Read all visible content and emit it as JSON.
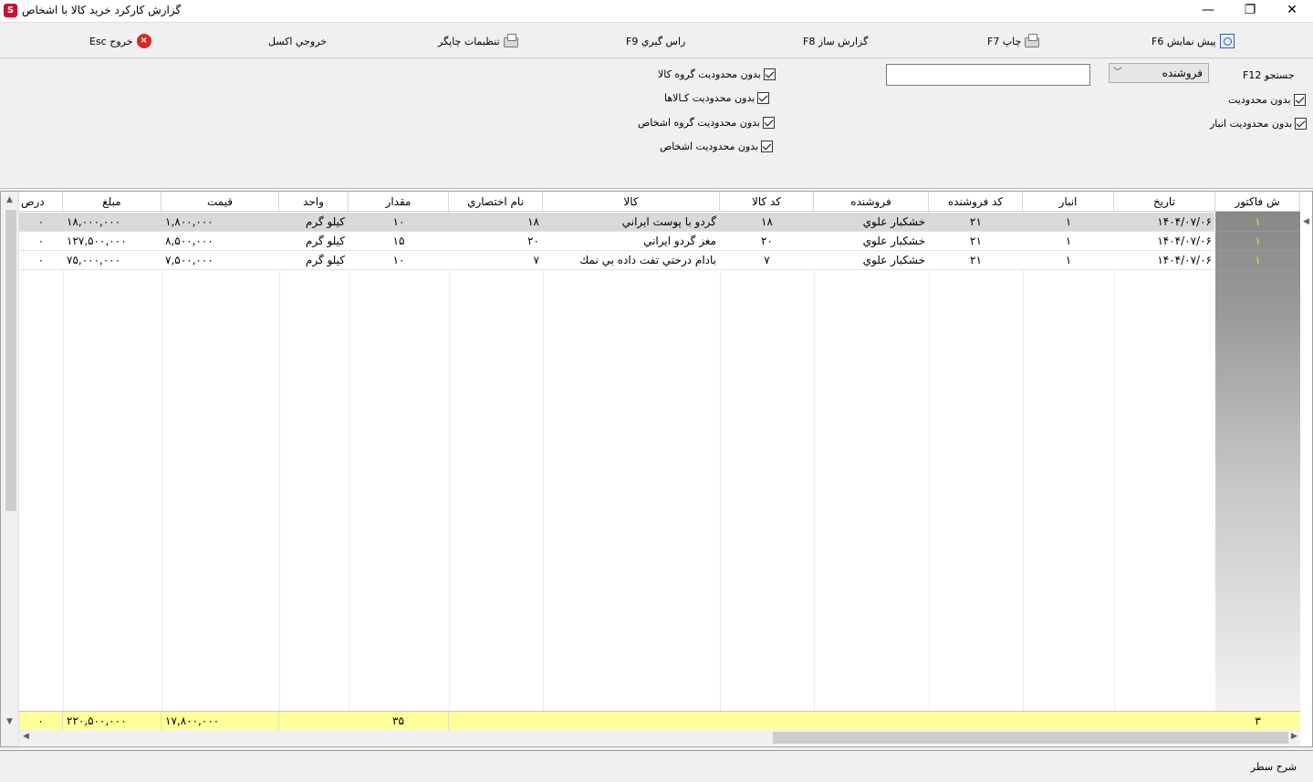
{
  "window": {
    "title": "گزارش کارکرد خريد کالا با اشخاص",
    "minimize": "—",
    "restore": "❐",
    "close": "✕"
  },
  "toolbar": {
    "preview": "پيش نمايش F6",
    "print": "چاپ F7",
    "report_builder": "گزارش ساز F8",
    "rounding": "راس گيري F9",
    "printer_settings": "تنظيمات چاپگر",
    "excel": "خروجي اكسل",
    "exit": "خروج Esc"
  },
  "filters": {
    "search_label": "جستجو F12",
    "search_combo_value": "فروشنده",
    "search_value": "",
    "no_limit": "بدون محدوديت",
    "no_limit_warehouse": "بدون محدوديت انبار",
    "no_limit_goods_group": "بدون محدوديت گروه كالا",
    "no_limit_goods": "بدون محدوديت كـالاها",
    "no_limit_persons_group": "بدون محدوديت گروه اشخاص",
    "no_limit_persons": "بدون محدوديت اشخاص"
  },
  "grid": {
    "columns": [
      "ش فاكتور",
      "تاريخ",
      "انبار",
      "كد فروشنده",
      "فروشنده",
      "كد كالا",
      "كالا",
      "نام اختصاري",
      "مقدار",
      "واحد",
      "قيمت",
      "مبلغ",
      "درص"
    ],
    "rows": [
      {
        "invoice": "۱",
        "date": "۱۴۰۴/۰۷/۰۶",
        "warehouse": "۱",
        "seller_code": "۲۱",
        "seller": "خشكبار علوي",
        "goods_code": "۱۸",
        "goods": "گردو با پوست ايراني",
        "short_name": "۱۸",
        "qty": "۱۰",
        "unit": "كيلو گرم",
        "price": "۱,۸۰۰,۰۰۰",
        "amount": "۱۸,۰۰۰,۰۰۰",
        "percent": "۰"
      },
      {
        "invoice": "۱",
        "date": "۱۴۰۴/۰۷/۰۶",
        "warehouse": "۱",
        "seller_code": "۲۱",
        "seller": "خشكبار علوي",
        "goods_code": "۲۰",
        "goods": "مغز گردو ايراني",
        "short_name": "۲۰",
        "qty": "۱۵",
        "unit": "كيلو گرم",
        "price": "۸,۵۰۰,۰۰۰",
        "amount": "۱۲۷,۵۰۰,۰۰۰",
        "percent": "۰"
      },
      {
        "invoice": "۱",
        "date": "۱۴۰۴/۰۷/۰۶",
        "warehouse": "۱",
        "seller_code": "۲۱",
        "seller": "خشكبار علوي",
        "goods_code": "۷",
        "goods": "بادام درختي تفت داده بي نمك",
        "short_name": "۷",
        "qty": "۱۰",
        "unit": "كيلو گرم",
        "price": "۷,۵۰۰,۰۰۰",
        "amount": "۷۵,۰۰۰,۰۰۰",
        "percent": "۰"
      }
    ],
    "totals": {
      "invoice_count": "۳",
      "qty": "۳۵",
      "price": "۱۷,۸۰۰,۰۰۰",
      "amount": "۲۲۰,۵۰۰,۰۰۰",
      "percent": "۰"
    }
  },
  "status": {
    "row_description": "شرح سطر"
  }
}
